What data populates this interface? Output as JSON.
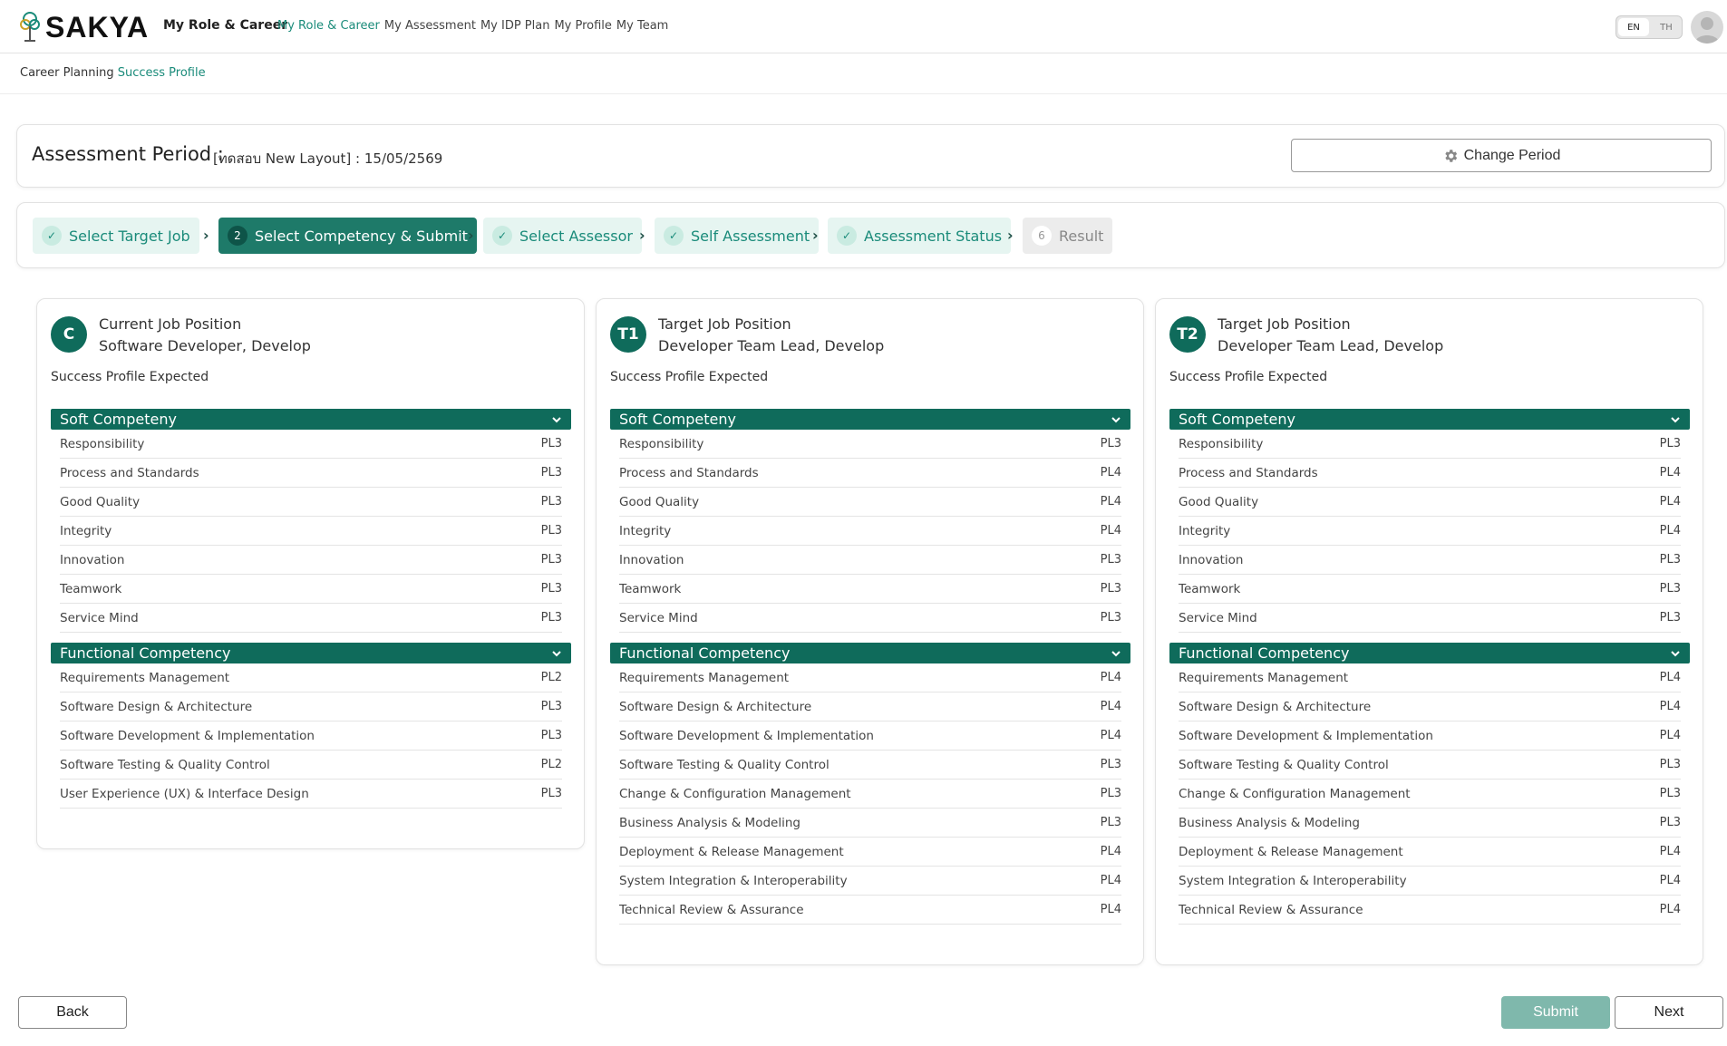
{
  "header": {
    "logo_text": "SAKYA",
    "brand": "My Role & Career",
    "nav": [
      {
        "label": "My Role & Career",
        "active": true
      },
      {
        "label": "My Assessment",
        "active": false
      },
      {
        "label": "My IDP Plan",
        "active": false
      },
      {
        "label": "My Profile",
        "active": false
      },
      {
        "label": "My Team",
        "active": false
      }
    ],
    "lang": {
      "en": "EN",
      "th": "TH",
      "selected": "EN"
    },
    "avatar_icon": "user-avatar-icon"
  },
  "breadcrumb": {
    "parent": "Career Planning",
    "current": "Success Profile"
  },
  "period": {
    "title": "Assessment Period :",
    "value": "[ทดสอบ New Layout] : 15/05/2569",
    "change_label": "Change Period",
    "change_icon": "gear-icon"
  },
  "steps": [
    {
      "label": "Select Target Job",
      "status": "done",
      "badge": ""
    },
    {
      "label": "Select Competency & Submit",
      "status": "current",
      "badge": "2"
    },
    {
      "label": "Select Assessor",
      "status": "done",
      "badge": ""
    },
    {
      "label": "Self Assessment",
      "status": "done",
      "badge": ""
    },
    {
      "label": "Assessment Status",
      "status": "done",
      "badge": ""
    },
    {
      "label": "Result",
      "status": "pending",
      "badge": "6"
    }
  ],
  "columns": [
    {
      "badge": "C",
      "label": "Current Job Position",
      "job": "Software Developer, Develop",
      "sub": "Success Profile Expected",
      "soft_title": "Soft Competeny",
      "soft": [
        {
          "name": "Responsibility",
          "level": "PL3"
        },
        {
          "name": "Process and Standards",
          "level": "PL3"
        },
        {
          "name": "Good Quality",
          "level": "PL3"
        },
        {
          "name": "Integrity",
          "level": "PL3"
        },
        {
          "name": "Innovation",
          "level": "PL3"
        },
        {
          "name": "Teamwork",
          "level": "PL3"
        },
        {
          "name": "Service Mind",
          "level": "PL3"
        }
      ],
      "func_title": "Functional Competency",
      "functional": [
        {
          "name": "Requirements Management",
          "level": "PL2"
        },
        {
          "name": "Software Design & Architecture",
          "level": "PL3"
        },
        {
          "name": "Software Development & Implementation",
          "level": "PL3"
        },
        {
          "name": "Software Testing & Quality Control",
          "level": "PL2"
        },
        {
          "name": "User Experience (UX) & Interface Design",
          "level": "PL3"
        }
      ]
    },
    {
      "badge": "T1",
      "label": "Target Job Position",
      "job": "Developer Team Lead, Develop",
      "sub": "Success Profile Expected",
      "soft_title": "Soft Competeny",
      "soft": [
        {
          "name": "Responsibility",
          "level": "PL3"
        },
        {
          "name": "Process and Standards",
          "level": "PL4"
        },
        {
          "name": "Good Quality",
          "level": "PL4"
        },
        {
          "name": "Integrity",
          "level": "PL4"
        },
        {
          "name": "Innovation",
          "level": "PL3"
        },
        {
          "name": "Teamwork",
          "level": "PL3"
        },
        {
          "name": "Service Mind",
          "level": "PL3"
        }
      ],
      "func_title": "Functional Competency",
      "functional": [
        {
          "name": "Requirements Management",
          "level": "PL4"
        },
        {
          "name": "Software Design & Architecture",
          "level": "PL4"
        },
        {
          "name": "Software Development & Implementation",
          "level": "PL4"
        },
        {
          "name": "Software Testing & Quality Control",
          "level": "PL3"
        },
        {
          "name": "Change & Configuration Management",
          "level": "PL3"
        },
        {
          "name": "Business Analysis & Modeling",
          "level": "PL3"
        },
        {
          "name": "Deployment & Release Management",
          "level": "PL4"
        },
        {
          "name": "System Integration & Interoperability",
          "level": "PL4"
        },
        {
          "name": "Technical Review & Assurance",
          "level": "PL4"
        }
      ]
    },
    {
      "badge": "T2",
      "label": "Target Job Position",
      "job": "Developer Team Lead, Develop",
      "sub": "Success Profile Expected",
      "soft_title": "Soft Competeny",
      "soft": [
        {
          "name": "Responsibility",
          "level": "PL3"
        },
        {
          "name": "Process and Standards",
          "level": "PL4"
        },
        {
          "name": "Good Quality",
          "level": "PL4"
        },
        {
          "name": "Integrity",
          "level": "PL4"
        },
        {
          "name": "Innovation",
          "level": "PL3"
        },
        {
          "name": "Teamwork",
          "level": "PL3"
        },
        {
          "name": "Service Mind",
          "level": "PL3"
        }
      ],
      "func_title": "Functional Competency",
      "functional": [
        {
          "name": "Requirements Management",
          "level": "PL4"
        },
        {
          "name": "Software Design & Architecture",
          "level": "PL4"
        },
        {
          "name": "Software Development & Implementation",
          "level": "PL4"
        },
        {
          "name": "Software Testing & Quality Control",
          "level": "PL3"
        },
        {
          "name": "Change & Configuration Management",
          "level": "PL3"
        },
        {
          "name": "Business Analysis & Modeling",
          "level": "PL3"
        },
        {
          "name": "Deployment & Release Management",
          "level": "PL4"
        },
        {
          "name": "System Integration & Interoperability",
          "level": "PL4"
        },
        {
          "name": "Technical Review & Assurance",
          "level": "PL4"
        }
      ]
    }
  ],
  "footer": {
    "back": "Back",
    "submit": "Submit",
    "next": "Next"
  },
  "colors": {
    "accent": "#0f6b5b",
    "link": "#1a8b7a",
    "submit_disabled": "#7fb8ac"
  }
}
